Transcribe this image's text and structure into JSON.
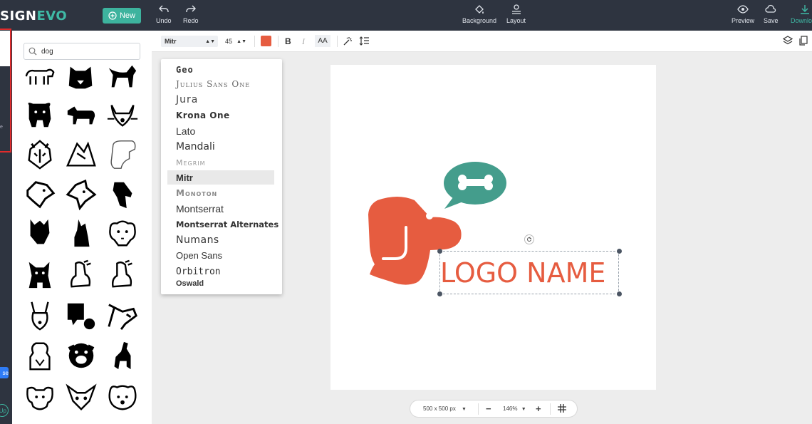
{
  "app": {
    "brand_part1": "SIGN",
    "brand_part2": "EVO",
    "new_label": "New"
  },
  "toolbar": {
    "undo_label": "Undo",
    "redo_label": "Redo",
    "background_label": "Background",
    "layout_label": "Layout",
    "preview_label": "Preview",
    "save_label": "Save",
    "download_label": "Download"
  },
  "search": {
    "value": "dog"
  },
  "left_rail": {
    "tag_label": "se",
    "up_label": "Up",
    "side_text": "e"
  },
  "format": {
    "font": "Mitr",
    "size": "45",
    "color": "#e65c40",
    "bold_label": "B",
    "italic_label": "I",
    "case_label": "AA"
  },
  "fonts": [
    {
      "name": "Geo",
      "selected": false
    },
    {
      "name": "Julius Sans One",
      "selected": false
    },
    {
      "name": "Jura",
      "selected": false
    },
    {
      "name": "Krona One",
      "selected": false
    },
    {
      "name": "Lato",
      "selected": false
    },
    {
      "name": "Mandali",
      "selected": false
    },
    {
      "name": "Megrim",
      "selected": false
    },
    {
      "name": "Mitr",
      "selected": true
    },
    {
      "name": "Monoton",
      "selected": false
    },
    {
      "name": "Montserrat",
      "selected": false
    },
    {
      "name": "Montserrat Alternates",
      "selected": false
    },
    {
      "name": "Numans",
      "selected": false
    },
    {
      "name": "Open Sans",
      "selected": false
    },
    {
      "name": "Orbitron",
      "selected": false
    },
    {
      "name": "Oswald",
      "selected": false
    }
  ],
  "canvas": {
    "logo_text": "LOGO NAME",
    "brand_color": "#e65c40",
    "accent_color": "#449d8c"
  },
  "bottom": {
    "size_label": "500 x 500 px",
    "zoom_label": "146%",
    "minus_label": "−",
    "plus_label": "+"
  },
  "icons": [
    "dog-walking-icon",
    "dog-face-icon",
    "dog-standing-icon",
    "pug-icon",
    "retriever-icon",
    "dog-whiskers-icon",
    "husky-icon",
    "dog-geometric-icon",
    "dog-outline-icon",
    "dog-head-outline-icon",
    "dog-head-angular-icon",
    "dog-head-silhouette-icon",
    "cat-dog-silhouette-icon",
    "sitting-dog-icon",
    "beagle-face-icon",
    "dog-ears-icon",
    "sitting-puppy-icon",
    "sitting-puppy-2-icon",
    "rabbit-dog-icon",
    "dog-with-bush-icon",
    "horse-dog-icon",
    "dog-bust-icon",
    "dog-round-face-icon",
    "terrier-icon",
    "dog-face-3-icon",
    "chihuahua-icon",
    "dog-face-4-icon"
  ]
}
